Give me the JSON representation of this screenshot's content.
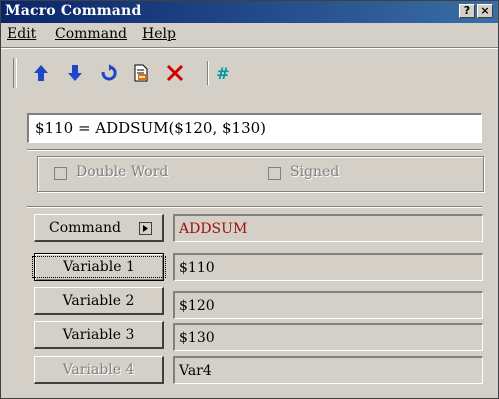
{
  "window": {
    "title": "Macro Command",
    "help_glyph": "?",
    "close_glyph": "×"
  },
  "menu": [
    "Edit",
    "Command",
    "Help"
  ],
  "toolbar": [
    {
      "icon": "move-up-icon",
      "color": "#1f45c8"
    },
    {
      "icon": "move-down-icon",
      "color": "#1f45c8"
    },
    {
      "icon": "undo-icon",
      "color": "#1f45c8"
    },
    {
      "icon": "insert-icon",
      "color": "#c06000"
    },
    {
      "icon": "delete-icon",
      "color": "#d00000"
    },
    {
      "icon": "hash-icon",
      "label": "#",
      "color": "#0098a0"
    }
  ],
  "expression": "$110 = ADDSUM($120, $130)",
  "options": {
    "double_word": "Double Word",
    "signed": "Signed"
  },
  "command": {
    "label": "Command",
    "value": "ADDSUM",
    "value_color": "#a01010"
  },
  "variables": [
    {
      "label": "Variable 1",
      "value": "$110"
    },
    {
      "label": "Variable 2",
      "value": "$120"
    },
    {
      "label": "Variable 3",
      "value": "$130"
    },
    {
      "label": "Variable 4",
      "value": "Var4"
    }
  ]
}
